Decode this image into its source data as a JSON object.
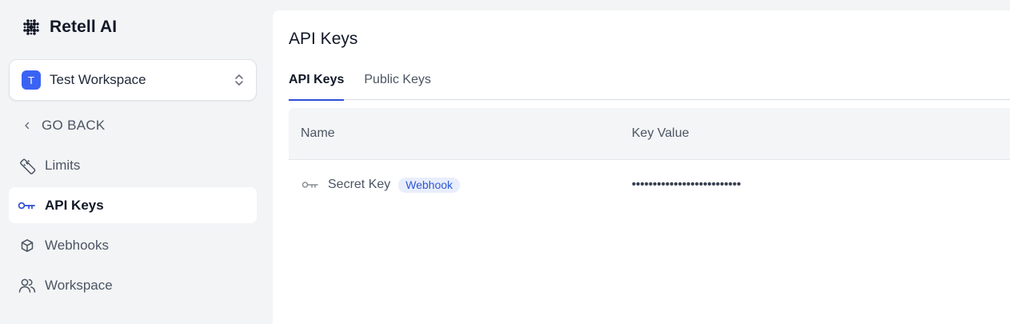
{
  "brand": {
    "name": "Retell AI"
  },
  "workspace": {
    "initial": "T",
    "name": "Test Workspace"
  },
  "nav": {
    "back": "GO BACK",
    "items": [
      {
        "label": "Limits",
        "icon": "ruler-icon"
      },
      {
        "label": "API Keys",
        "icon": "key-icon",
        "active": true
      },
      {
        "label": "Webhooks",
        "icon": "cube-icon"
      },
      {
        "label": "Workspace",
        "icon": "users-icon"
      }
    ]
  },
  "main": {
    "title": "API Keys",
    "tabs": [
      {
        "label": "API Keys",
        "active": true
      },
      {
        "label": "Public Keys",
        "active": false
      }
    ],
    "table": {
      "columns": [
        "Name",
        "Key Value"
      ],
      "rows": [
        {
          "name": "Secret Key",
          "badge": "Webhook",
          "value": "••••••••••••••••••••••••••"
        }
      ]
    }
  },
  "colors": {
    "accent": "#2f4fd9",
    "avatar": "#3b63f3",
    "badge_bg": "#e8eefc"
  }
}
